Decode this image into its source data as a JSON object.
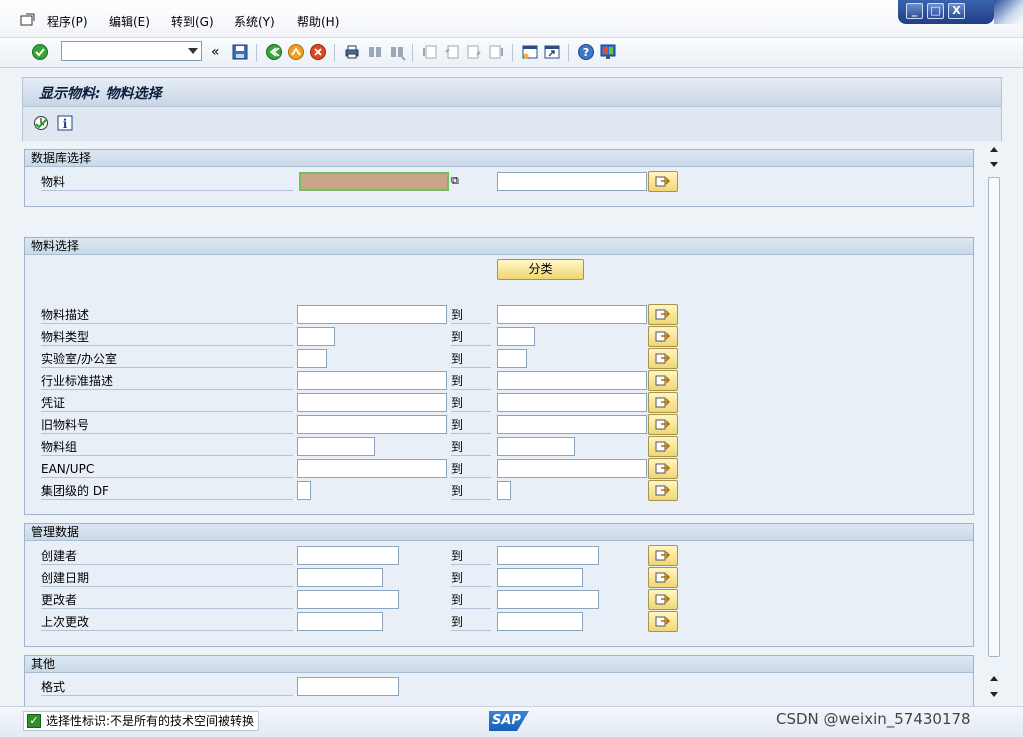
{
  "menu": {
    "items": [
      "程序(P)",
      "编辑(E)",
      "转到(G)",
      "系统(Y)",
      "帮助(H)"
    ]
  },
  "window_controls": [
    "_",
    "□",
    "X"
  ],
  "toolbar": {
    "command_field_value": "",
    "icons": [
      "enter-icon",
      "double-chevron-icon",
      "save-icon",
      "back-icon",
      "exit-icon",
      "cancel-icon",
      "print-icon",
      "find-icon",
      "find-next-icon",
      "first-page-icon",
      "prev-page-icon",
      "next-page-icon",
      "last-page-icon",
      "new-session-icon",
      "shortcut-icon",
      "help-icon",
      "layout-icon"
    ]
  },
  "title": "显示物料: 物料选择",
  "app_toolbar_icons": [
    "execute-icon",
    "info-icon"
  ],
  "groups": {
    "db_select": {
      "header": "数据库选择",
      "rows": [
        {
          "label": "物料",
          "from": "",
          "to": ""
        }
      ]
    },
    "material_select": {
      "header": "物料选择",
      "class_button": "分类",
      "to_label": "到",
      "rows": [
        {
          "label": "物料描述",
          "from": "",
          "to": ""
        },
        {
          "label": "物料类型",
          "from": "",
          "to": ""
        },
        {
          "label": "实验室/办公室",
          "from": "",
          "to": ""
        },
        {
          "label": "行业标准描述",
          "from": "",
          "to": ""
        },
        {
          "label": "凭证",
          "from": "",
          "to": ""
        },
        {
          "label": "旧物料号",
          "from": "",
          "to": ""
        },
        {
          "label": "物料组",
          "from": "",
          "to": ""
        },
        {
          "label": "EAN/UPC",
          "from": "",
          "to": ""
        },
        {
          "label": "集团级的 DF",
          "from": "",
          "to": ""
        }
      ]
    },
    "admin_data": {
      "header": "管理数据",
      "to_label": "到",
      "rows": [
        {
          "label": "创建者",
          "from": "",
          "to": ""
        },
        {
          "label": "创建日期",
          "from": "",
          "to": ""
        },
        {
          "label": "更改者",
          "from": "",
          "to": ""
        },
        {
          "label": "上次更改",
          "from": "",
          "to": ""
        }
      ]
    },
    "other": {
      "header": "其他",
      "rows": [
        {
          "label": "格式",
          "from": ""
        }
      ]
    }
  },
  "status": {
    "message": "选择性标识:不是所有的技术空间被转换",
    "logo": "SAP",
    "watermark": "CSDN @weixin_57430178"
  },
  "colors": {
    "active_field": "#c9a48a",
    "active_field_border": "#6fc35a",
    "multi_button": "#f1d676",
    "header_blue": "#1f3f86"
  }
}
